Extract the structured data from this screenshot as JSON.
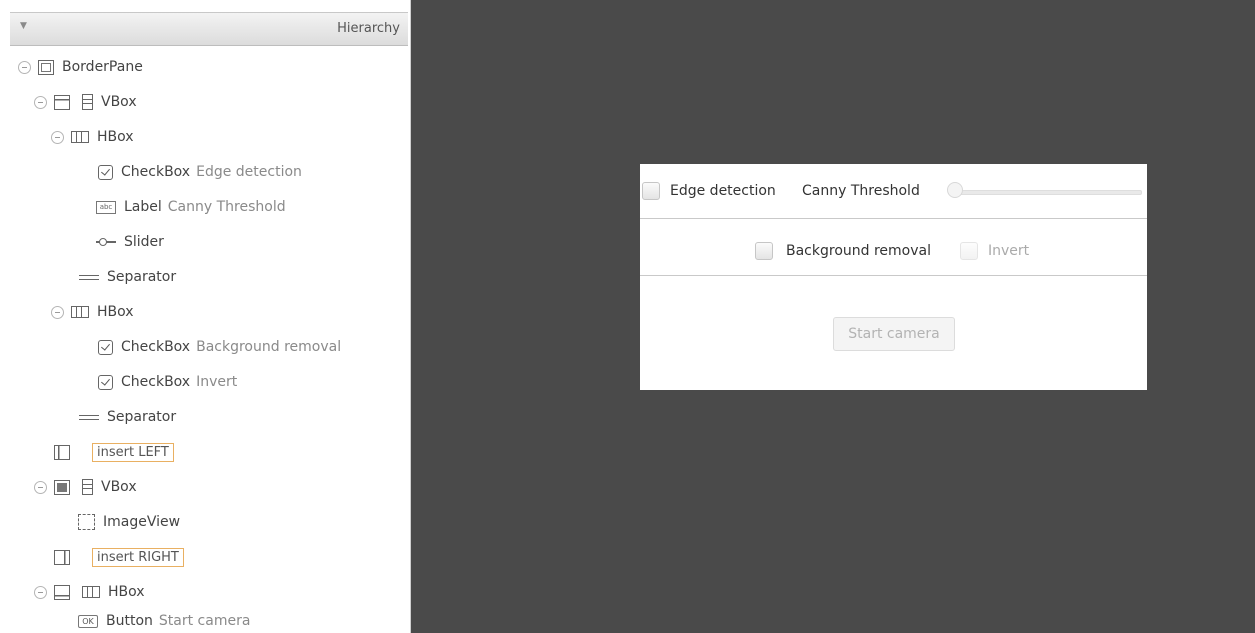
{
  "panel": {
    "title": "Hierarchy",
    "toggle_glyph": "▼"
  },
  "tree": [
    {
      "type": "BorderPane",
      "detail": "",
      "icon": "border-pane-icon",
      "expanded": true
    },
    {
      "type": "VBox",
      "detail": "",
      "icon": "vbox-icon",
      "region_icon": "top-region-icon",
      "expanded": true
    },
    {
      "type": "HBox",
      "detail": "",
      "icon": "hbox-icon",
      "expanded": true
    },
    {
      "type": "CheckBox",
      "detail": "Edge detection",
      "icon": "checkbox-icon"
    },
    {
      "type": "Label",
      "detail": "Canny Threshold",
      "icon": "label-icon",
      "icon_text": "abc"
    },
    {
      "type": "Slider",
      "detail": "",
      "icon": "slider-icon"
    },
    {
      "type": "Separator",
      "detail": "",
      "icon": "separator-icon"
    },
    {
      "type": "HBox",
      "detail": "",
      "icon": "hbox-icon",
      "expanded": true
    },
    {
      "type": "CheckBox",
      "detail": "Background removal",
      "icon": "checkbox-icon"
    },
    {
      "type": "CheckBox",
      "detail": "Invert",
      "icon": "checkbox-icon"
    },
    {
      "type": "Separator",
      "detail": "",
      "icon": "separator-icon"
    },
    {
      "type": "insert LEFT",
      "detail": "",
      "icon": "left-region-icon",
      "placeholder": true
    },
    {
      "type": "VBox",
      "detail": "",
      "icon": "vbox-icon",
      "region_icon": "center-region-icon",
      "expanded": true
    },
    {
      "type": "ImageView",
      "detail": "",
      "icon": "imageview-icon"
    },
    {
      "type": "insert RIGHT",
      "detail": "",
      "icon": "right-region-icon",
      "placeholder": true
    },
    {
      "type": "HBox",
      "detail": "",
      "icon": "hbox-icon",
      "region_icon": "bottom-region-icon",
      "expanded": true
    },
    {
      "type": "Button",
      "detail": "Start camera",
      "icon": "button-icon",
      "icon_text": "OK"
    }
  ],
  "preview": {
    "edge_detection_label": "Edge detection",
    "edge_detection_checked": false,
    "canny_threshold_label": "Canny Threshold",
    "slider_value": 0,
    "background_removal_label": "Background removal",
    "background_removal_checked": false,
    "invert_label": "Invert",
    "invert_disabled": true,
    "start_camera_label": "Start camera",
    "start_camera_disabled": true
  },
  "colors": {
    "canvas_background": "#4a4a4a",
    "placeholder_border": "#e9b062"
  }
}
